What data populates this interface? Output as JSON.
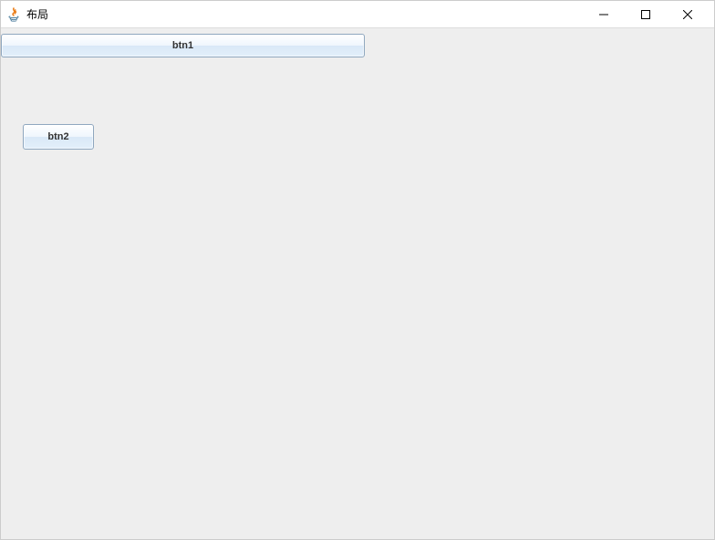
{
  "window": {
    "title": "布局"
  },
  "buttons": {
    "btn1": "btn1",
    "btn2": "btn2"
  }
}
